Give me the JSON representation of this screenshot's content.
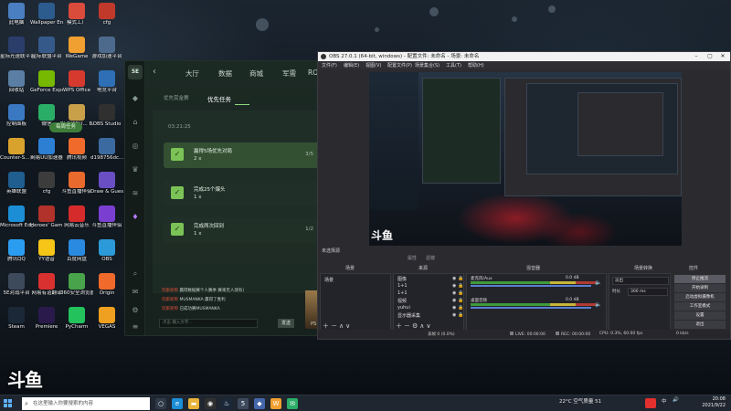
{
  "desktop": {
    "icons": [
      {
        "label": "此电脑",
        "color": "#4a7fc1"
      },
      {
        "label": "Wallpaper Engine: ...",
        "color": "#2c5b8e"
      },
      {
        "label": "模式工厂",
        "color": "#d94b3b"
      },
      {
        "label": "cfg",
        "color": "#c0392b"
      },
      {
        "label": "星际光速联平台",
        "color": "#2a3d6b"
      },
      {
        "label": "星际联盟平台",
        "color": "#355a8a"
      },
      {
        "label": "WeGame",
        "color": "#f0a030"
      },
      {
        "label": "游戏加速平台",
        "color": "#4d6a8c"
      },
      {
        "label": "回收站",
        "color": "#5b7fa4"
      },
      {
        "label": "GeForce Experience",
        "color": "#76b900"
      },
      {
        "label": "WPS Office",
        "color": "#d63a2e"
      },
      {
        "label": "电竞平台",
        "color": "#2e6fb5"
      },
      {
        "label": "控制面板",
        "color": "#3a78c2"
      },
      {
        "label": "微信",
        "color": "#2aae67"
      },
      {
        "label": "PLAYERU... BATTLEGR...",
        "color": "#c8a04a"
      },
      {
        "label": "OBS Studio",
        "color": "#303030"
      },
      {
        "label": "Counter-S... Global Off...",
        "color": "#d9a22c"
      },
      {
        "label": "网易UU加速器",
        "color": "#2d7fd3"
      },
      {
        "label": "腾讯视频",
        "color": "#f06a2c"
      },
      {
        "label": "d198756dc...",
        "color": "#3b6aa0"
      },
      {
        "label": "英雄联盟",
        "color": "#1f5e8f"
      },
      {
        "label": "cfg",
        "color": "#3c3c3c"
      },
      {
        "label": "斗鱼直播伴侣",
        "color": "#e86a2c"
      },
      {
        "label": "Draw & Guess",
        "color": "#6a4fc4"
      },
      {
        "label": "Microsoft Edge",
        "color": "#1b8ed6"
      },
      {
        "label": "Heroes' Gam...",
        "color": "#b0322a"
      },
      {
        "label": "网易云音乐",
        "color": "#d52b2b"
      },
      {
        "label": "斗鱼直播伴侣",
        "color": "#7a3fd1"
      },
      {
        "label": "腾讯QQ",
        "color": "#2b9df0"
      },
      {
        "label": "YY语音",
        "color": "#f5c518"
      },
      {
        "label": "百度网盘",
        "color": "#2a8ae0"
      },
      {
        "label": "OBS",
        "color": "#2c9ad8"
      },
      {
        "label": "5E对战平台",
        "color": "#3d4a5c"
      },
      {
        "label": "网易有道翻译",
        "color": "#d93030"
      },
      {
        "label": "360安全浏览器",
        "color": "#49a34a"
      },
      {
        "label": "Origin",
        "color": "#f06a2c"
      },
      {
        "label": "Steam",
        "color": "#1b2838"
      },
      {
        "label": "Premiere",
        "color": "#2a1a4c"
      },
      {
        "label": "PyCharm",
        "color": "#23c25d"
      },
      {
        "label": "VEGAS",
        "color": "#f0a020"
      }
    ]
  },
  "launcher": {
    "logo": "5E",
    "back": "‹",
    "nav": [
      "大厅",
      "数据",
      "商城",
      "军需",
      "ROI"
    ],
    "subtabs": [
      "优先赏金赛",
      "优先任务"
    ],
    "priority_btn": "每周任务",
    "timer": "03:21:25",
    "tasks": [
      {
        "name": "赢得5场优先对局",
        "count": "2 x",
        "progress": "3/5"
      },
      {
        "name": "完成25个爆头",
        "count": "1 x",
        "progress": ""
      },
      {
        "name": "完成两次回到",
        "count": "1 x",
        "progress": "1/2"
      }
    ],
    "chat": [
      {
        "name": "玩家昵称",
        "text": "赢得数据赛个人赛季 赛来无人测有)"
      },
      {
        "name": "玩家昵称",
        "text": "MUSMANKA 赢得了胜利"
      },
      {
        "name": "玩家昵称",
        "text": "已成功赛MUSMANKA"
      }
    ],
    "chat_placeholder": "点击 输入文字...",
    "send": "发送",
    "pf": "PS"
  },
  "obs": {
    "title": "OBS 27.0.1 (64-bit, windows) - 配置文件: 未命名 - 场景: 未命名",
    "menu": [
      "文件(F)",
      "编辑(E)",
      "视图(V)",
      "配置文件(P)",
      "场景集合(S)",
      "工具(T)",
      "帮助(H)"
    ],
    "preview_label": "未选择源",
    "props_btn": "属性",
    "filters_btn": "滤镜",
    "dock_headers": [
      "场景",
      "来源",
      "混音器",
      "场景转换",
      "控件"
    ],
    "scenes": [
      "场景"
    ],
    "sources": [
      "图像",
      "1+1",
      "1+1",
      "视频",
      "yuhui",
      "显示器采集"
    ],
    "mixer": [
      {
        "name": "麦克风/Aux",
        "db": "0.0 dB"
      },
      {
        "name": "桌面音频",
        "db": "0.0 dB"
      }
    ],
    "transition": {
      "type_label": "淡出",
      "duration_label": "时长",
      "duration": "300 ms"
    },
    "controls": [
      "停止推流",
      "开始录制",
      "启动虚拟摄像机",
      "工作室模式",
      "设置",
      "退出"
    ],
    "status": {
      "live": "LIVE: 00:00:00",
      "rec": "REC: 00:00:00",
      "cpu": "CPU: 0.3%, 60.00 fps",
      "drop": "丢帧 0 (0.0%)",
      "kbps": "0 kb/s"
    }
  },
  "watermark": "斗鱼",
  "taskbar": {
    "search_placeholder": "在这里输入你要搜索的内容",
    "weather": "22°C 空气质量 51",
    "ime": "中",
    "time": "20:08",
    "date": "2021/9/22",
    "apps": [
      {
        "icon": "task-view-icon",
        "glyph": "○",
        "color": "#2f3a48"
      },
      {
        "icon": "edge-icon",
        "glyph": "e",
        "color": "#1b8ed6"
      },
      {
        "icon": "file-explorer-icon",
        "glyph": "▬",
        "color": "#e8b339"
      },
      {
        "icon": "obs-icon",
        "glyph": "◉",
        "color": "#303030"
      },
      {
        "icon": "steam-icon",
        "glyph": "♨",
        "color": "#1b2838"
      },
      {
        "icon": "5e-icon",
        "glyph": "5",
        "color": "#3d4a5c"
      },
      {
        "icon": "game-icon",
        "glyph": "◆",
        "color": "#4466aa"
      },
      {
        "icon": "wegame-icon",
        "glyph": "W",
        "color": "#f0a030"
      },
      {
        "icon": "chat-icon",
        "glyph": "✉",
        "color": "#2aae67"
      }
    ]
  },
  "colors": {
    "accent_green": "#7bc356",
    "obs_bg": "#2b2b2f",
    "launcher_bg": "#1c2a24"
  }
}
